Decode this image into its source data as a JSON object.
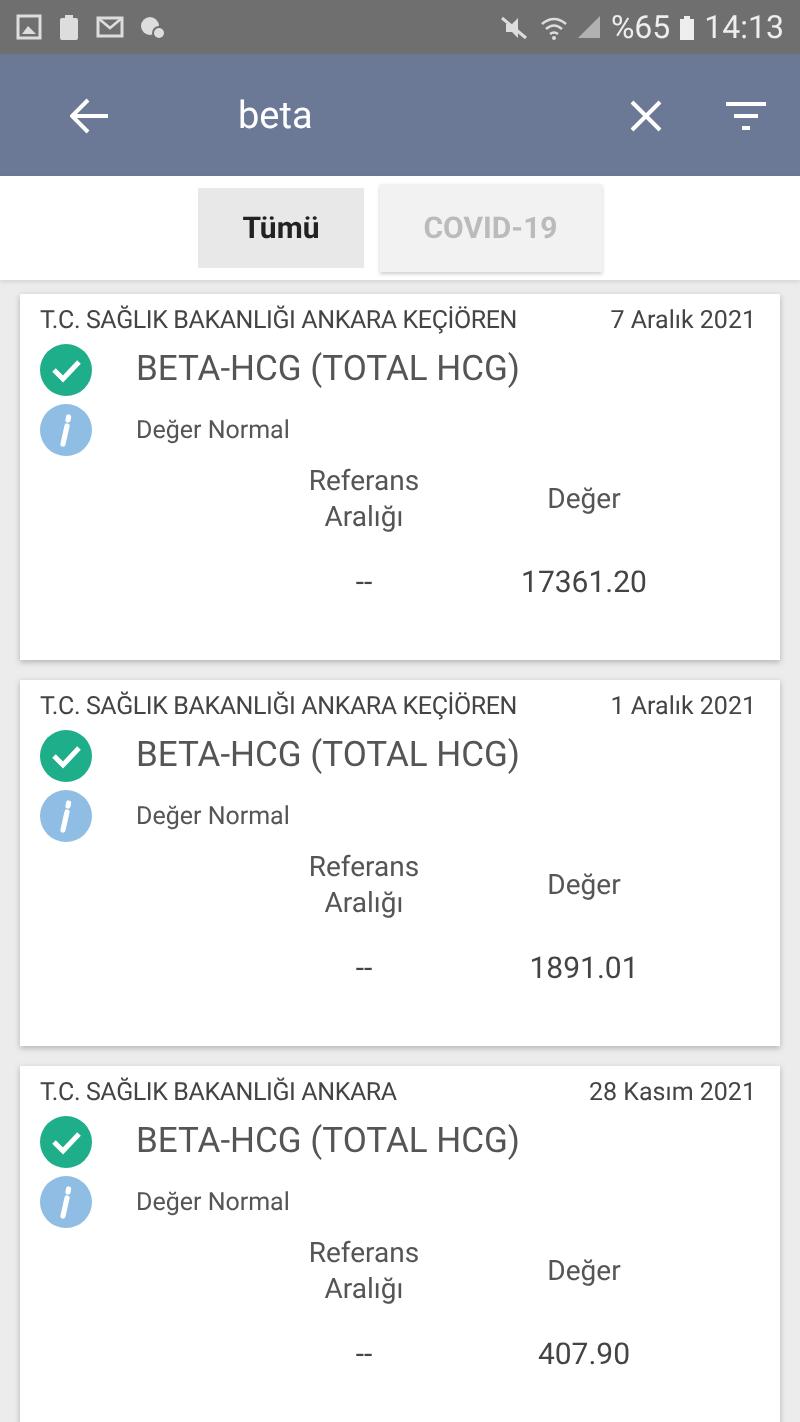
{
  "status_bar": {
    "battery": "%65",
    "time": "14:13"
  },
  "search": {
    "value": "beta"
  },
  "tabs": [
    {
      "label": "Tümü",
      "selected": true
    },
    {
      "label": "COVID-19",
      "selected": false
    }
  ],
  "results": [
    {
      "institution": "T.C. SAĞLIK BAKANLIĞI ANKARA KEÇİÖREN",
      "date": "7 Aralık 2021",
      "test": "BETA-HCG (TOTAL HCG)",
      "status": "Değer Normal",
      "ok": true,
      "columns": [
        "Referans Aralığı",
        "Değer"
      ],
      "values": [
        "--",
        "17361.20"
      ]
    },
    {
      "institution": "T.C. SAĞLIK BAKANLIĞI ANKARA KEÇİÖREN",
      "date": "1 Aralık 2021",
      "test": "BETA-HCG (TOTAL HCG)",
      "status": "Değer Normal",
      "ok": true,
      "columns": [
        "Referans Aralığı",
        "Değer"
      ],
      "values": [
        "--",
        "1891.01"
      ]
    },
    {
      "institution": "T.C. SAĞLIK BAKANLIĞI ANKARA",
      "date": "28 Kasım 2021",
      "test": "BETA-HCG (TOTAL HCG)",
      "status": "Değer Normal",
      "ok": true,
      "columns": [
        "Referans Aralığı",
        "Değer"
      ],
      "values": [
        "--",
        "407.90"
      ]
    }
  ]
}
